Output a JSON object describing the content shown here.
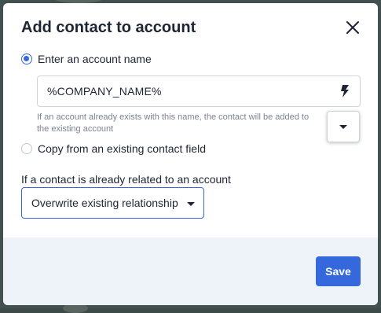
{
  "modal": {
    "title": "Add contact to account",
    "close_icon": "close-icon"
  },
  "options": {
    "account_name": {
      "label": "Enter an account name",
      "selected": true,
      "value": "%COMPANY_NAME%",
      "action_icon": "bolt-icon",
      "helper_text": "If an account already exists with this name, the contact will be added to the existing account",
      "helper_line1": "If an account already exists with this name, the contact will be added to",
      "helper_line2": "the existing account"
    },
    "copy_field": {
      "label": "Copy from an existing contact field",
      "selected": false
    }
  },
  "relationship": {
    "label": "If a contact is already related to an account",
    "selected_value": "Overwrite existing relationship"
  },
  "footer": {
    "save_label": "Save"
  },
  "colors": {
    "accent": "#3468dc",
    "text": "#1d2433",
    "helper": "#7b8392",
    "footer_bg": "#eef2f9"
  }
}
